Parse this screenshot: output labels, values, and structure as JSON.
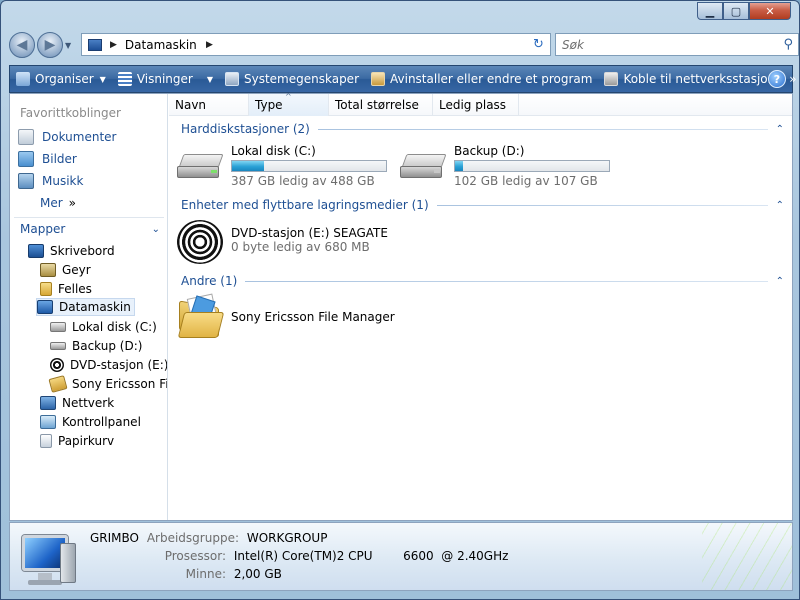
{
  "window": {
    "caption": {
      "minimize": "▁",
      "maximize": "▢",
      "close": "✕"
    }
  },
  "address_bar": {
    "path": "Datamaskin",
    "search_placeholder": "Søk"
  },
  "command_bar": {
    "items": [
      {
        "label": "Organiser",
        "icon": "organize-icon",
        "dropdown": true
      },
      {
        "label": "Visninger",
        "icon": "views-icon",
        "dropdown": true
      },
      {
        "label": "Systemegenskaper",
        "icon": "system-properties-icon"
      },
      {
        "label": "Avinstaller eller endre et program",
        "icon": "uninstall-icon"
      },
      {
        "label": "Koble til nettverksstasjon",
        "icon": "map-network-drive-icon"
      }
    ],
    "more": "»",
    "help": "?"
  },
  "navigation": {
    "favorites_title": "Favorittkoblinger",
    "favorites": [
      {
        "label": "Dokumenter",
        "icon": "documents-icon"
      },
      {
        "label": "Bilder",
        "icon": "pictures-icon"
      },
      {
        "label": "Musikk",
        "icon": "music-icon"
      },
      {
        "label": "Mer",
        "icon": "more-chevron-icon"
      }
    ],
    "more_chevron": "»",
    "folders_title": "Mapper",
    "tree": [
      {
        "label": "Skrivebord",
        "icon": "desktop-icon"
      },
      {
        "label": "Geyr",
        "icon": "user-folder-icon"
      },
      {
        "label": "Felles",
        "icon": "public-folder-icon"
      },
      {
        "label": "Datamaskin",
        "icon": "computer-icon",
        "selected": true
      },
      {
        "label": "Lokal disk (C:)",
        "icon": "hard-disk-icon"
      },
      {
        "label": "Backup (D:)",
        "icon": "hard-disk-icon"
      },
      {
        "label": "DVD-stasjon (E:) S",
        "icon": "dvd-drive-icon"
      },
      {
        "label": "Sony Ericsson File",
        "icon": "sony-ericsson-icon"
      },
      {
        "label": "Nettverk",
        "icon": "network-icon"
      },
      {
        "label": "Kontrollpanel",
        "icon": "control-panel-icon"
      },
      {
        "label": "Papirkurv",
        "icon": "recycle-bin-icon"
      }
    ]
  },
  "columns": [
    "Navn",
    "Type",
    "Total størrelse",
    "Ledig plass"
  ],
  "groups": {
    "hdd": {
      "title": "Harddiskstasjoner (2)",
      "drives": [
        {
          "name": "Lokal disk (C:)",
          "free_text": "387 GB ledig av 488 GB",
          "used_fraction": 0.21
        },
        {
          "name": "Backup (D:)",
          "free_text": "102 GB ledig av 107 GB",
          "used_fraction": 0.05
        }
      ]
    },
    "removable": {
      "title": "Enheter med flyttbare lagringsmedier (1)",
      "drives": [
        {
          "name": "DVD-stasjon (E:) SEAGATE",
          "free_text": "0 byte ledig av 680 MB"
        }
      ]
    },
    "other": {
      "title": "Andre (1)",
      "items": [
        {
          "name": "Sony Ericsson File Manager"
        }
      ]
    }
  },
  "details_pane": {
    "computer_name": "GRIMBO",
    "workgroup_label": "Arbeidsgruppe:",
    "workgroup_value": "WORKGROUP",
    "processor_label": "Prosessor:",
    "processor_value": "Intel(R) Core(TM)2 CPU        6600  @ 2.40GHz",
    "memory_label": "Minne:",
    "memory_value": "2,00 GB"
  },
  "colors": {
    "link_blue": "#1e4f93",
    "command_bar": "#3b6aa3",
    "progress_fill": "#2aa1d6"
  }
}
